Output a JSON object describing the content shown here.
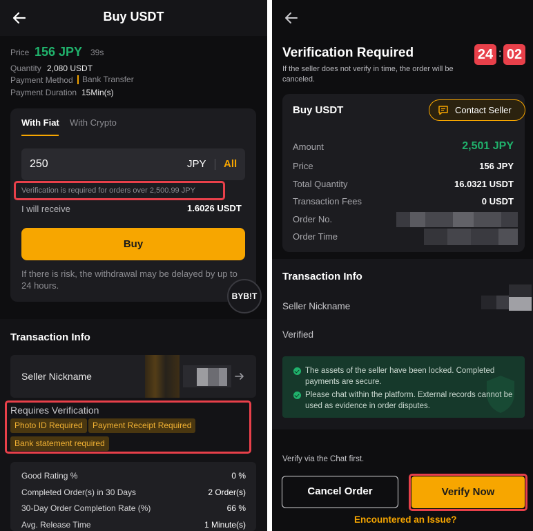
{
  "left": {
    "header": {
      "title": "Buy USDT"
    },
    "price": {
      "label": "Price",
      "value": "156 JPY",
      "countdown": "39s"
    },
    "quantity": {
      "label": "Quantity",
      "value": "2,080 USDT"
    },
    "payment_method": {
      "label": "Payment Method",
      "value": "Bank Transfer"
    },
    "payment_duration": {
      "label": "Payment Duration",
      "value": "15Min(s)"
    },
    "tabs": [
      "With Fiat",
      "With Crypto"
    ],
    "amount_input": {
      "value": "250",
      "currency": "JPY",
      "all_label": "All"
    },
    "verification_note": "Verification is required for orders over 2,500.99 JPY",
    "receive": {
      "label": "I will receive",
      "value": "1.6026 USDT"
    },
    "buy_button": "Buy",
    "risk_note": "If there is risk, the withdrawal may be delayed by up to 24 hours.",
    "brand_badge": "BYB!T",
    "transaction_info_title": "Transaction Info",
    "seller_nickname_label": "Seller Nickname",
    "requires_verification": {
      "title": "Requires Verification",
      "chips": [
        "Photo ID Required",
        "Payment Receipt Required",
        "Bank statement required"
      ]
    },
    "stats": [
      {
        "label": "Good Rating %",
        "value": "0 %"
      },
      {
        "label": "Completed Order(s) in 30 Days",
        "value": "2 Order(s)"
      },
      {
        "label": "30-Day Order Completion Rate (%)",
        "value": "66 %"
      },
      {
        "label": "Avg. Release Time",
        "value": "1 Minute(s)"
      }
    ]
  },
  "right": {
    "title": "Verification Required",
    "timer": {
      "minutes": "24",
      "separator": ":",
      "seconds": "02"
    },
    "subtitle": "If the seller does not verify in time, the order will be canceled.",
    "order_card": {
      "title": "Buy USDT",
      "contact_button": "Contact Seller",
      "rows": [
        {
          "label": "Amount",
          "value": "2,501 JPY"
        },
        {
          "label": "Price",
          "value": "156 JPY"
        },
        {
          "label": "Total Quantity",
          "value": "16.0321 USDT"
        },
        {
          "label": "Transaction Fees",
          "value": "0 USDT"
        },
        {
          "label": "Order No.",
          "value": ""
        },
        {
          "label": "Order Time",
          "value": ""
        }
      ]
    },
    "transaction_info_title": "Transaction Info",
    "seller_nickname_label": "Seller Nickname",
    "verified_label": "Verified",
    "notices": [
      "The assets of the seller have been locked. Completed payments are secure.",
      "Please chat within the platform. External records cannot be used as evidence in order disputes."
    ],
    "chat_hint": "Verify via the Chat first.",
    "cancel_button": "Cancel Order",
    "verify_button": "Verify Now",
    "issue_link": "Encountered an Issue?"
  },
  "colors": {
    "accent": "#f7a600",
    "positive": "#20b26c",
    "alert": "#e8404a",
    "background": "#0e0e10"
  }
}
